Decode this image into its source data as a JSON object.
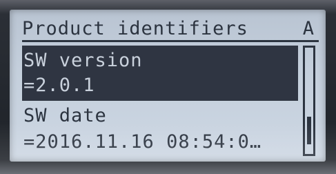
{
  "screen": {
    "title": "Product identifiers",
    "title_flag": "A",
    "items": [
      {
        "label": "SW version",
        "value": "=2.0.1",
        "selected": true
      },
      {
        "label": "SW date",
        "value": "=2016.11.16 08:54:0…",
        "selected": false
      }
    ]
  },
  "colors": {
    "lcd_background": "#c4cfdc",
    "lcd_foreground": "#2c3440",
    "selection_background": "#2f3542"
  },
  "scrollbar": {
    "position_fraction": 0.75
  }
}
